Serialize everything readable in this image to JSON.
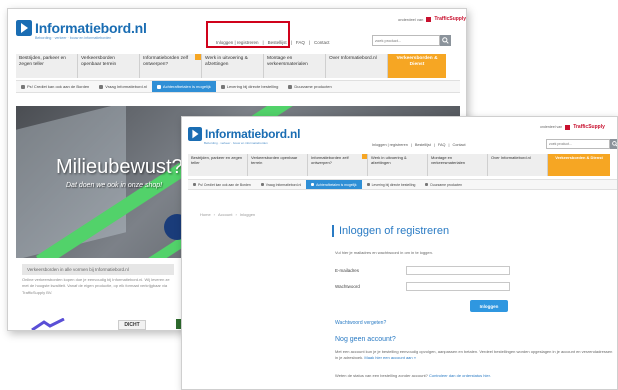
{
  "site": {
    "logo_text": "Informatiebord.nl",
    "logo_tagline": "Bebording · verkeer · bouw en informatieborden",
    "brand_prefix": "onderdeel van",
    "brand_name": "TrafficSupply",
    "top_links": [
      "Inloggen | registreren",
      "Bestellijst",
      "FAQ",
      "Contact"
    ],
    "search_placeholder": "zoek product...",
    "nav": [
      "Bestrijden, parkeer en zegen teller",
      "Verkeersborden openbaar terrein",
      "Informatieborden zelf ontwerpen?",
      "Werk in uitvoering & afzettingen",
      "Montage en verkeersmaterialen",
      "Over Informatiebord.nl",
      "Verkeersborden & Dienst"
    ],
    "strip": [
      "Ps! Crediet kan ook aan de Borden",
      "Vraag Informatiebord.nl",
      "Achterafbetalen is mogelijk",
      "Levering bij directe bestelling",
      "Duurzame producten"
    ]
  },
  "back": {
    "hero_title": "Milieubewust?",
    "hero_sub": "Dat doen we ook in onze shop!",
    "bar_text": "Verkeersborden in alle vormen bij Informatiebord.nl",
    "body_text": "Online verkeersborden kopen doe je eenvoudig bij Informatiebord.nl. Wij leveren ze met de hoogste kwaliteit. Vanaf de eigen productie, op elk formaat verkrijgbaar via TrafficSupply BV.",
    "thumb_label": "DICHT"
  },
  "front": {
    "breadcrumb": [
      "Home",
      "Account",
      "Inloggen"
    ],
    "heading": "Inloggen of registreren",
    "intro": "Vul hier je mailadres en wachtwoord in om in te loggen.",
    "email_label": "E-mailadres",
    "password_label": "Wachtwoord",
    "login_button": "Inloggen",
    "forgot_link": "Wachtwoord vergeten?",
    "no_account_heading": "Nog geen account?",
    "register_text": "Met een account kun je je bestelling eenvoudig opvolgen, aanpassen en betalen. Verdeel bestellingen worden opgeslagen in je account en verzendadressen in je adresboek.",
    "register_link": "Maak hier een account aan »",
    "status_text": "Weten de status van een bestelling zonder account?",
    "status_link": "Controleer dan de orderstatus hier."
  },
  "colors": {
    "brand_blue": "#1a6db3",
    "accent_orange": "#f6a623",
    "highlight_red": "#d0021b",
    "button_blue": "#2f97e0"
  }
}
